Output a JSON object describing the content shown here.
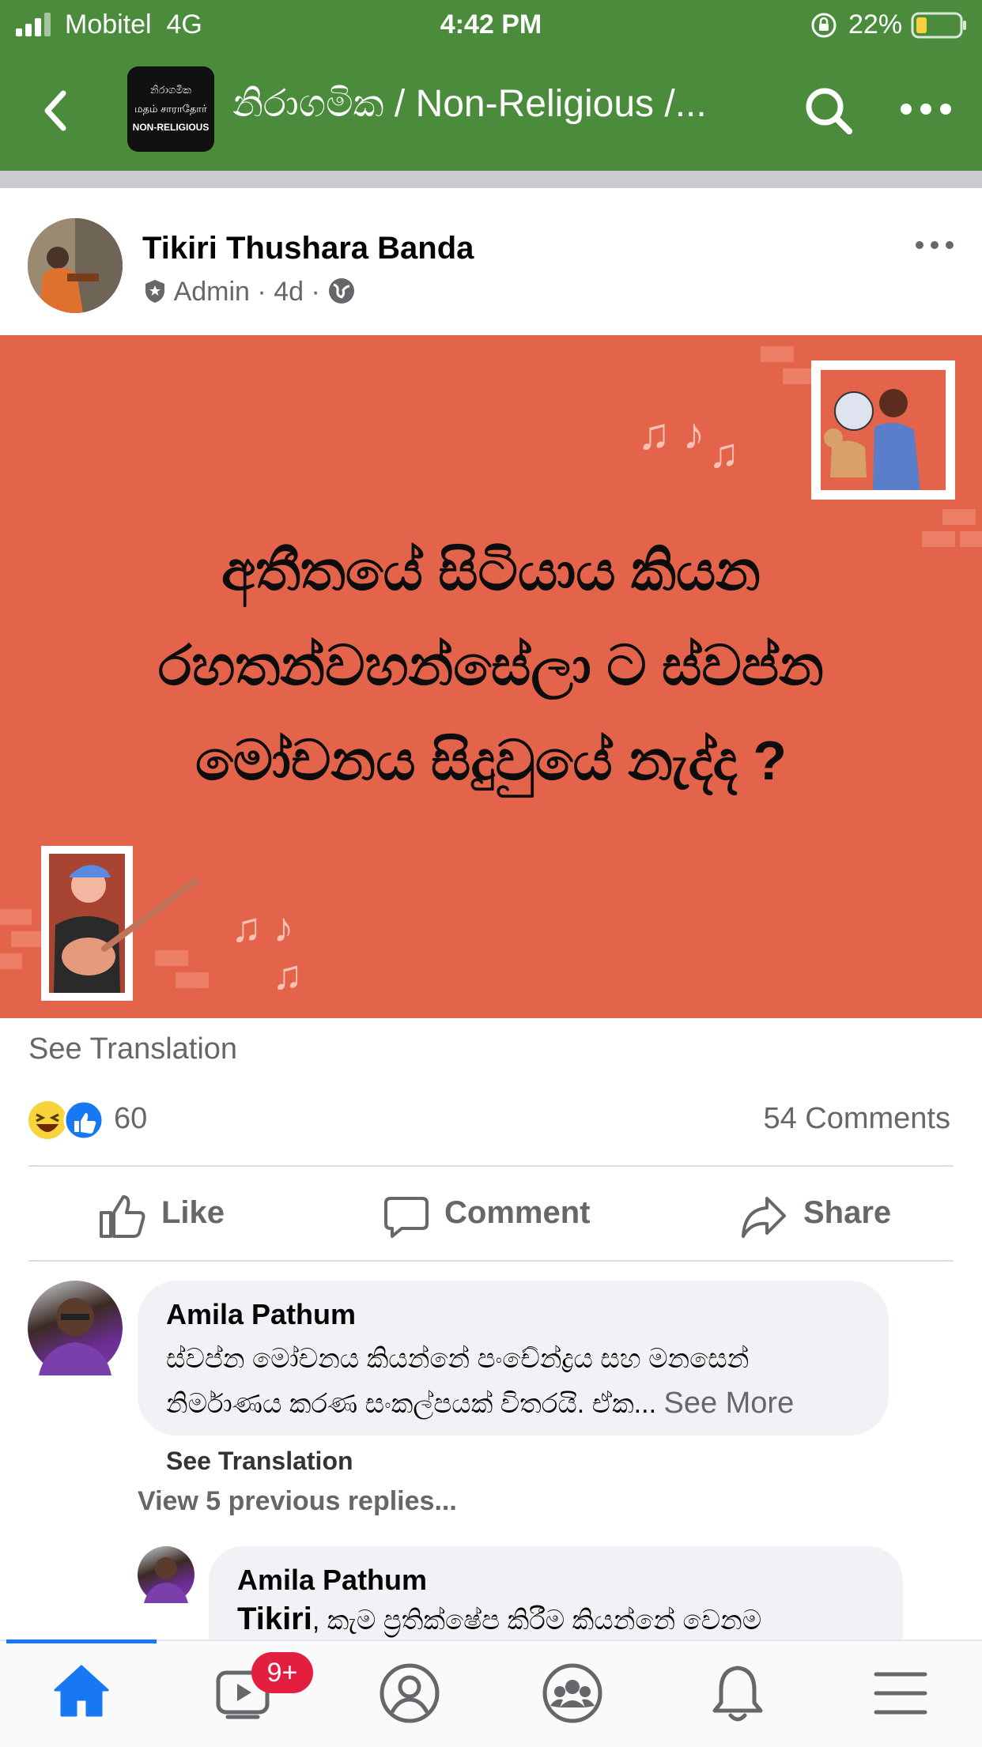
{
  "status_bar": {
    "carrier": "Mobitel",
    "network": "4G",
    "time": "4:42 PM",
    "battery": "22%"
  },
  "nav": {
    "title": "නිරාගමික / Non-Religious /...",
    "logo_lines": [
      "නිරාගමික",
      "மதம் சாராதோர்",
      "NON-RELIGIOUS"
    ]
  },
  "post": {
    "author": "Tikiri Thushara Banda",
    "role": "Admin",
    "age": "4d",
    "banner_lines": [
      "අතීතයේ සිටියාය කියන",
      "රහතන්වහන්සේලා ට ස්වප්න",
      "මෝචනය සිදුවුයේ නැද්ද ?"
    ],
    "see_translation": "See Translation",
    "reaction_count": "60",
    "comment_count": "54 Comments"
  },
  "actions": {
    "like": "Like",
    "comment": "Comment",
    "share": "Share"
  },
  "comments": {
    "first": {
      "name": "Amila Pathum",
      "line1": "ස්වප්න මෝචනය කියන්නේ පංචේන්ද්‍රය සහ මනසෙන්",
      "line2": "නිර්මාණය කරණ සංකල්පයක් විතරයි. ඒක...",
      "see_more": "See More",
      "see_translation": "See Translation"
    },
    "view_replies": "View 5 previous replies...",
    "reply": {
      "name": "Amila Pathum",
      "mention": "Tikiri",
      "text": ", කැම ප්‍රතික්ෂේප කිරීම කියන්නේ වෙනම"
    }
  },
  "tabbar": {
    "video_badge": "9+",
    "active_tab": "home"
  },
  "colors": {
    "header_green": "#4a8b3c",
    "banner": "#e3644a",
    "accent_blue": "#1877f2",
    "badge_red": "#e41e3f"
  }
}
